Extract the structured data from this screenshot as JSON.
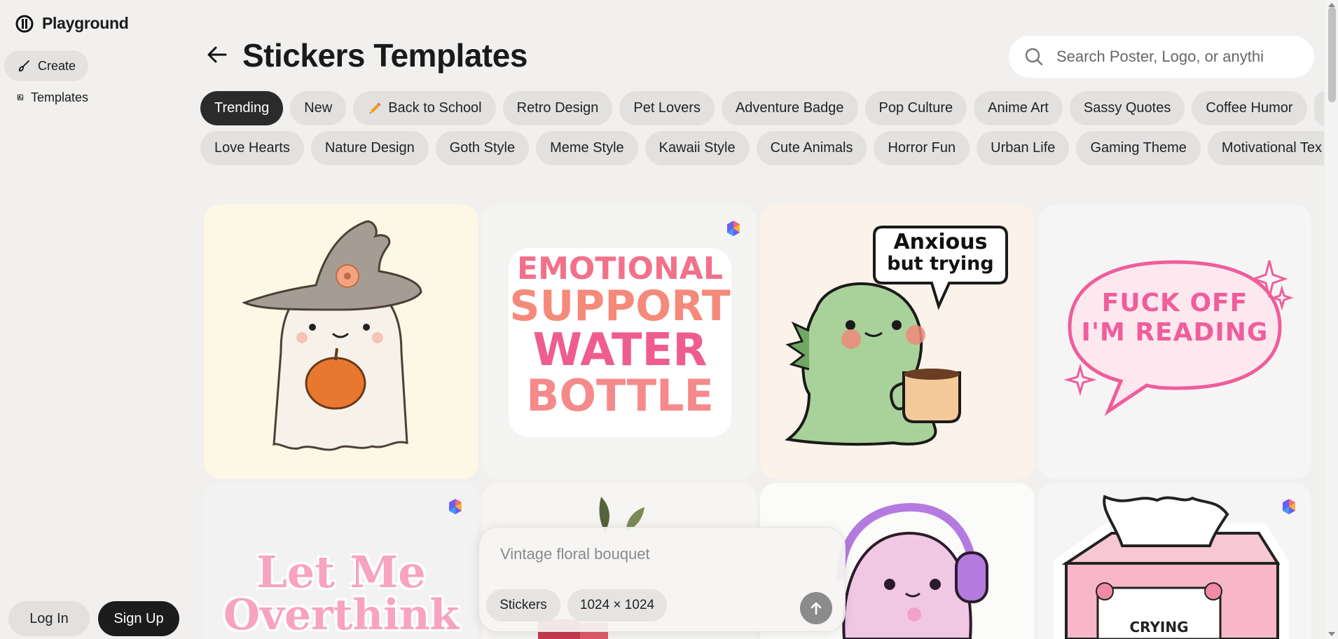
{
  "app": {
    "name": "Playground"
  },
  "sidebar": {
    "items": [
      {
        "label": "Create",
        "icon": "brush-icon",
        "active": true
      },
      {
        "label": "Templates",
        "icon": "templates-icon",
        "active": false
      }
    ],
    "login_label": "Log In",
    "signup_label": "Sign Up"
  },
  "header": {
    "title": "Stickers Templates",
    "search_placeholder": "Search Poster, Logo, or anythi"
  },
  "chips": {
    "row1": [
      "Trending",
      "New",
      "Back to School",
      "Retro Design",
      "Pet Lovers",
      "Adventure Badge",
      "Pop Culture",
      "Anime Art",
      "Sassy Quotes",
      "Coffee Humor"
    ],
    "row2": [
      "Love Hearts",
      "Nature Design",
      "Goth Style",
      "Meme Style",
      "Kawaii Style",
      "Cute Animals",
      "Horror Fun",
      "Urban Life",
      "Gaming Theme",
      "Motivational Tex"
    ],
    "active": "Trending"
  },
  "stickers": {
    "water_bottle": [
      "EMOTIONAL",
      "SUPPORT",
      "WATER",
      "BOTTLE"
    ],
    "dino_line1": "Anxious",
    "dino_line2": "but trying",
    "reading_line1": "FUCK OFF",
    "reading_line2": "I'M READING",
    "overthink_line1": "Let Me",
    "overthink_line2": "Overthink",
    "tissue_label": "CRYING"
  },
  "composer": {
    "placeholder": "Vintage floral bouquet",
    "type_label": "Stickers",
    "size_label": "1024 × 1024"
  },
  "colors": {
    "accent_dark": "#2b2b2b",
    "chip_bg": "#e2e1e0",
    "page_bg": "#f1f0ef"
  }
}
